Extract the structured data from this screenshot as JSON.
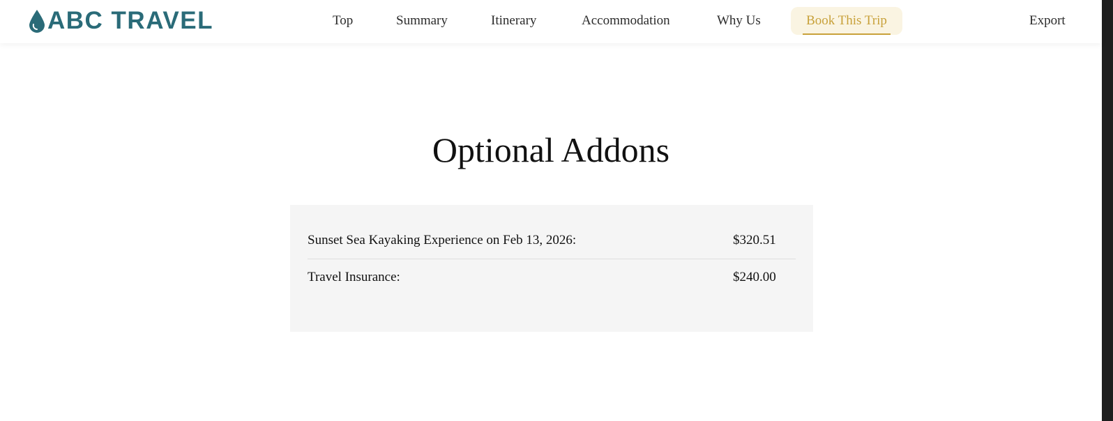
{
  "brand": {
    "name": "ABC TRAVEL",
    "color": "#2a6b78"
  },
  "nav": {
    "items": [
      "Top",
      "Summary",
      "Itinerary",
      "Accommodation",
      "Why Us"
    ],
    "cta_label": "Book This Trip",
    "cta_color": "#c8a13a",
    "export_label": "Export"
  },
  "section": {
    "title": "Optional Addons"
  },
  "addons": [
    {
      "label": "Sunset Sea Kayaking Experience on Feb 13, 2026:",
      "price": "$320.51"
    },
    {
      "label": "Travel Insurance:",
      "price": "$240.00"
    }
  ]
}
